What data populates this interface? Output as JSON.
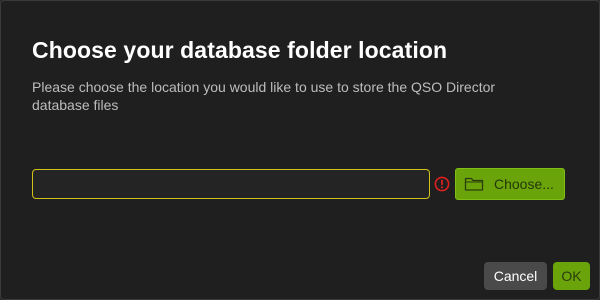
{
  "dialog": {
    "title": "Choose your database folder location",
    "subtitle": "Please choose the location you would like to use to store the QSO Director database files"
  },
  "folder_input": {
    "value": "",
    "placeholder": "",
    "status_icon": "error-exclamation-icon",
    "border_color": "#d4c21a",
    "status_color": "#e02020"
  },
  "choose_button": {
    "label": "Choose...",
    "icon": "folder-icon",
    "color": "#6aa40a"
  },
  "footer": {
    "cancel_label": "Cancel",
    "ok_label": "OK"
  }
}
